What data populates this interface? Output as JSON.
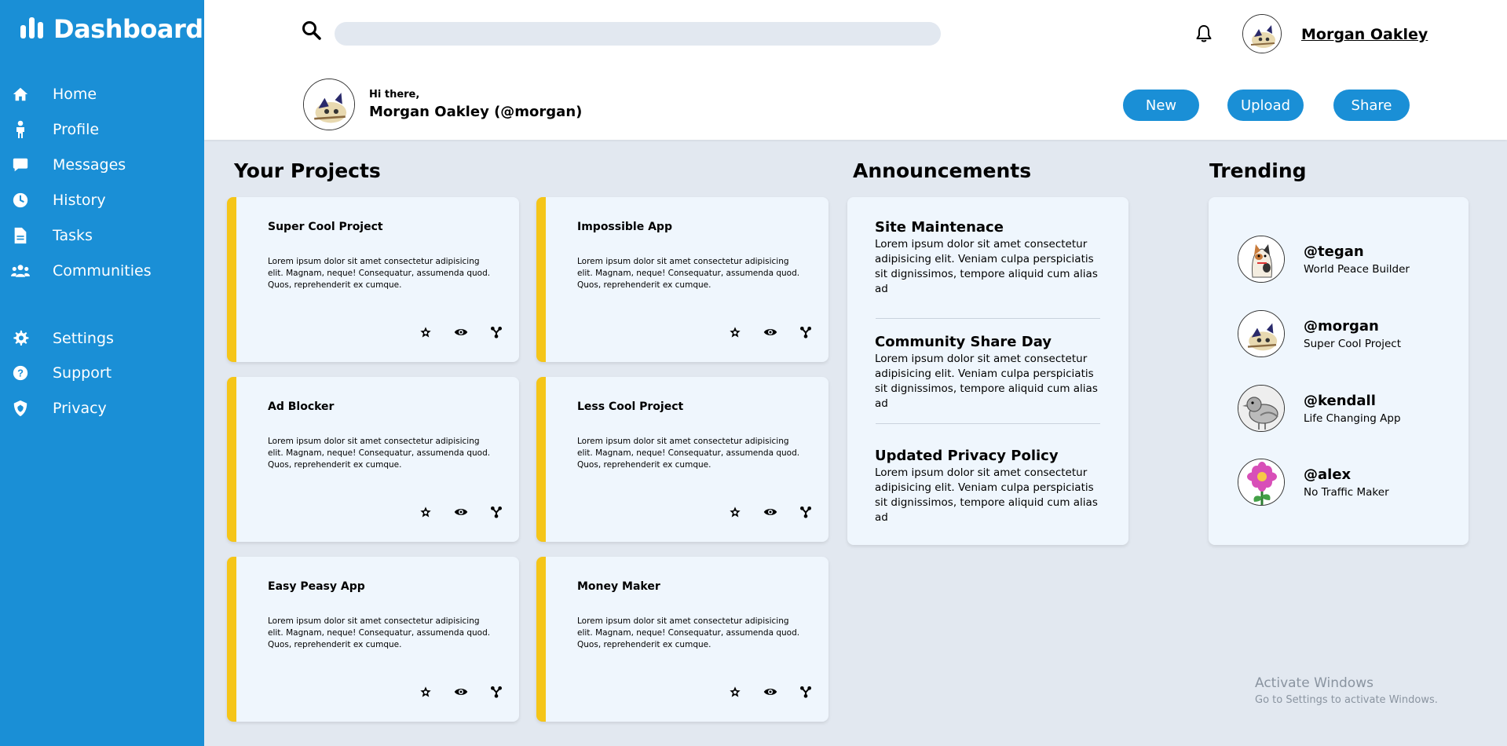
{
  "sidebar": {
    "title": "Dashboard",
    "items": [
      {
        "label": "Home",
        "icon": "home-icon"
      },
      {
        "label": "Profile",
        "icon": "person-icon"
      },
      {
        "label": "Messages",
        "icon": "chat-icon"
      },
      {
        "label": "History",
        "icon": "clock-icon"
      },
      {
        "label": "Tasks",
        "icon": "document-icon"
      },
      {
        "label": "Communities",
        "icon": "users-icon"
      },
      {
        "label": "Settings",
        "icon": "gear-icon"
      },
      {
        "label": "Support",
        "icon": "question-icon"
      },
      {
        "label": "Privacy",
        "icon": "shield-icon"
      }
    ]
  },
  "header": {
    "search_placeholder": "",
    "username": "Morgan Oakley",
    "greeting_small": "Hi there,",
    "greeting_name": "Morgan Oakley (@morgan)",
    "buttons": {
      "new": "New",
      "upload": "Upload",
      "share": "Share"
    }
  },
  "projects": {
    "title": "Your Projects",
    "cards": [
      {
        "title": "Super Cool Project",
        "desc": "Lorem ipsum dolor sit amet consectetur adipisicing elit. Magnam, neque! Consequatur, assumenda quod. Quos, reprehenderit ex cumque."
      },
      {
        "title": "Impossible App",
        "desc": "Lorem ipsum dolor sit amet consectetur adipisicing elit. Magnam, neque! Consequatur, assumenda quod. Quos, reprehenderit ex cumque."
      },
      {
        "title": "Ad Blocker",
        "desc": "Lorem ipsum dolor sit amet consectetur adipisicing elit. Magnam, neque! Consequatur, assumenda quod. Quos, reprehenderit ex cumque."
      },
      {
        "title": "Less Cool Project",
        "desc": "Lorem ipsum dolor sit amet consectetur adipisicing elit. Magnam, neque! Consequatur, assumenda quod. Quos, reprehenderit ex cumque."
      },
      {
        "title": "Easy Peasy App",
        "desc": "Lorem ipsum dolor sit amet consectetur adipisicing elit. Magnam, neque! Consequatur, assumenda quod. Quos, reprehenderit ex cumque."
      },
      {
        "title": "Money Maker",
        "desc": "Lorem ipsum dolor sit amet consectetur adipisicing elit. Magnam, neque! Consequatur, assumenda quod. Quos, reprehenderit ex cumque."
      }
    ]
  },
  "announcements": {
    "title": "Announcements",
    "items": [
      {
        "title": "Site Maintenace",
        "text": "Lorem ipsum dolor sit amet consectetur adipisicing elit. Veniam culpa perspiciatis sit dignissimos, tempore aliquid cum alias ad"
      },
      {
        "title": "Community Share Day",
        "text": "Lorem ipsum dolor sit amet consectetur adipisicing elit. Veniam culpa perspiciatis sit dignissimos, tempore aliquid cum alias ad"
      },
      {
        "title": "Updated Privacy Policy",
        "text": "Lorem ipsum dolor sit amet consectetur adipisicing elit. Veniam culpa perspiciatis sit dignissimos, tempore aliquid cum alias ad"
      }
    ]
  },
  "trending": {
    "title": "Trending",
    "items": [
      {
        "handle": "@tegan",
        "project": "World Peace Builder"
      },
      {
        "handle": "@morgan",
        "project": "Super Cool Project"
      },
      {
        "handle": "@kendall",
        "project": "Life Changing App"
      },
      {
        "handle": "@alex",
        "project": "No Traffic Maker"
      }
    ]
  },
  "watermark": {
    "line1": "Activate Windows",
    "line2": "Go to Settings to activate Windows."
  },
  "colors": {
    "accent": "#1a8fd6",
    "card_stripe": "#f5c518",
    "background": "#e2e8f0",
    "card_bg": "#eff6fd"
  }
}
